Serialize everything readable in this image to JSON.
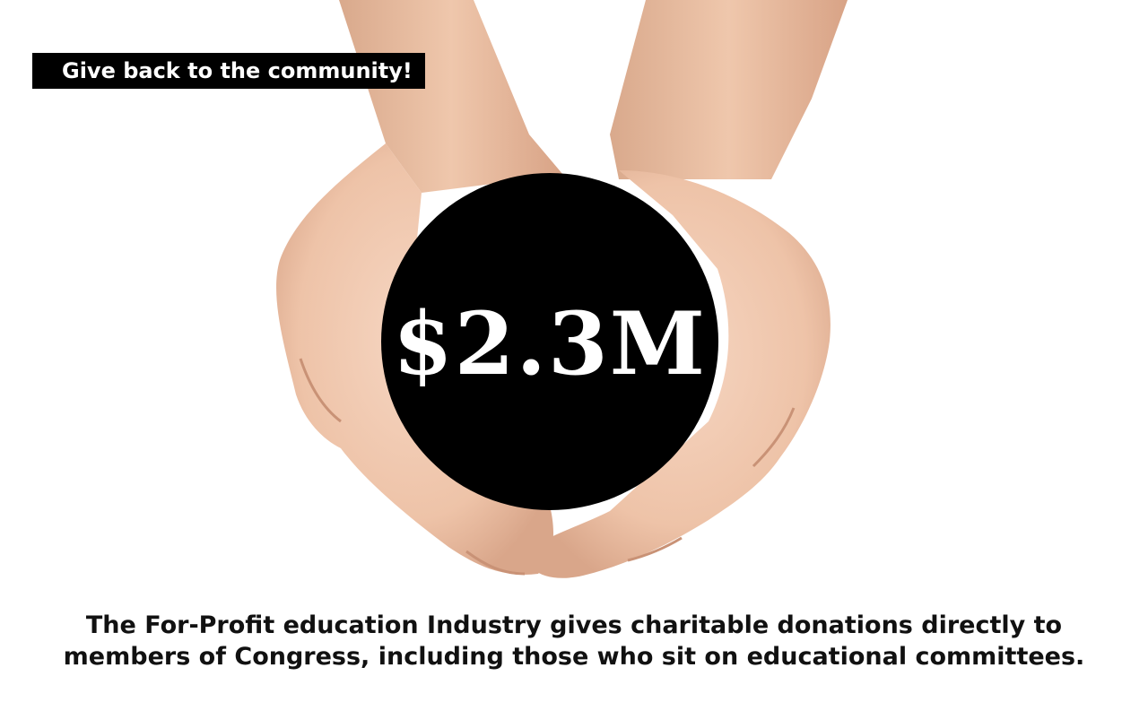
{
  "banner": {
    "text": "Give back to the community!"
  },
  "amount": {
    "value": "$2.3M"
  },
  "caption": {
    "line1": "The For-Profit education Industry gives charitable donations directly to",
    "line2": "members of Congress, including those who sit on educational committees."
  },
  "colors": {
    "background": "#ffffff",
    "banner": "#000000",
    "circle": "#000000",
    "skin": "#efc9b0"
  },
  "image": {
    "subject": "cupped-hands"
  }
}
